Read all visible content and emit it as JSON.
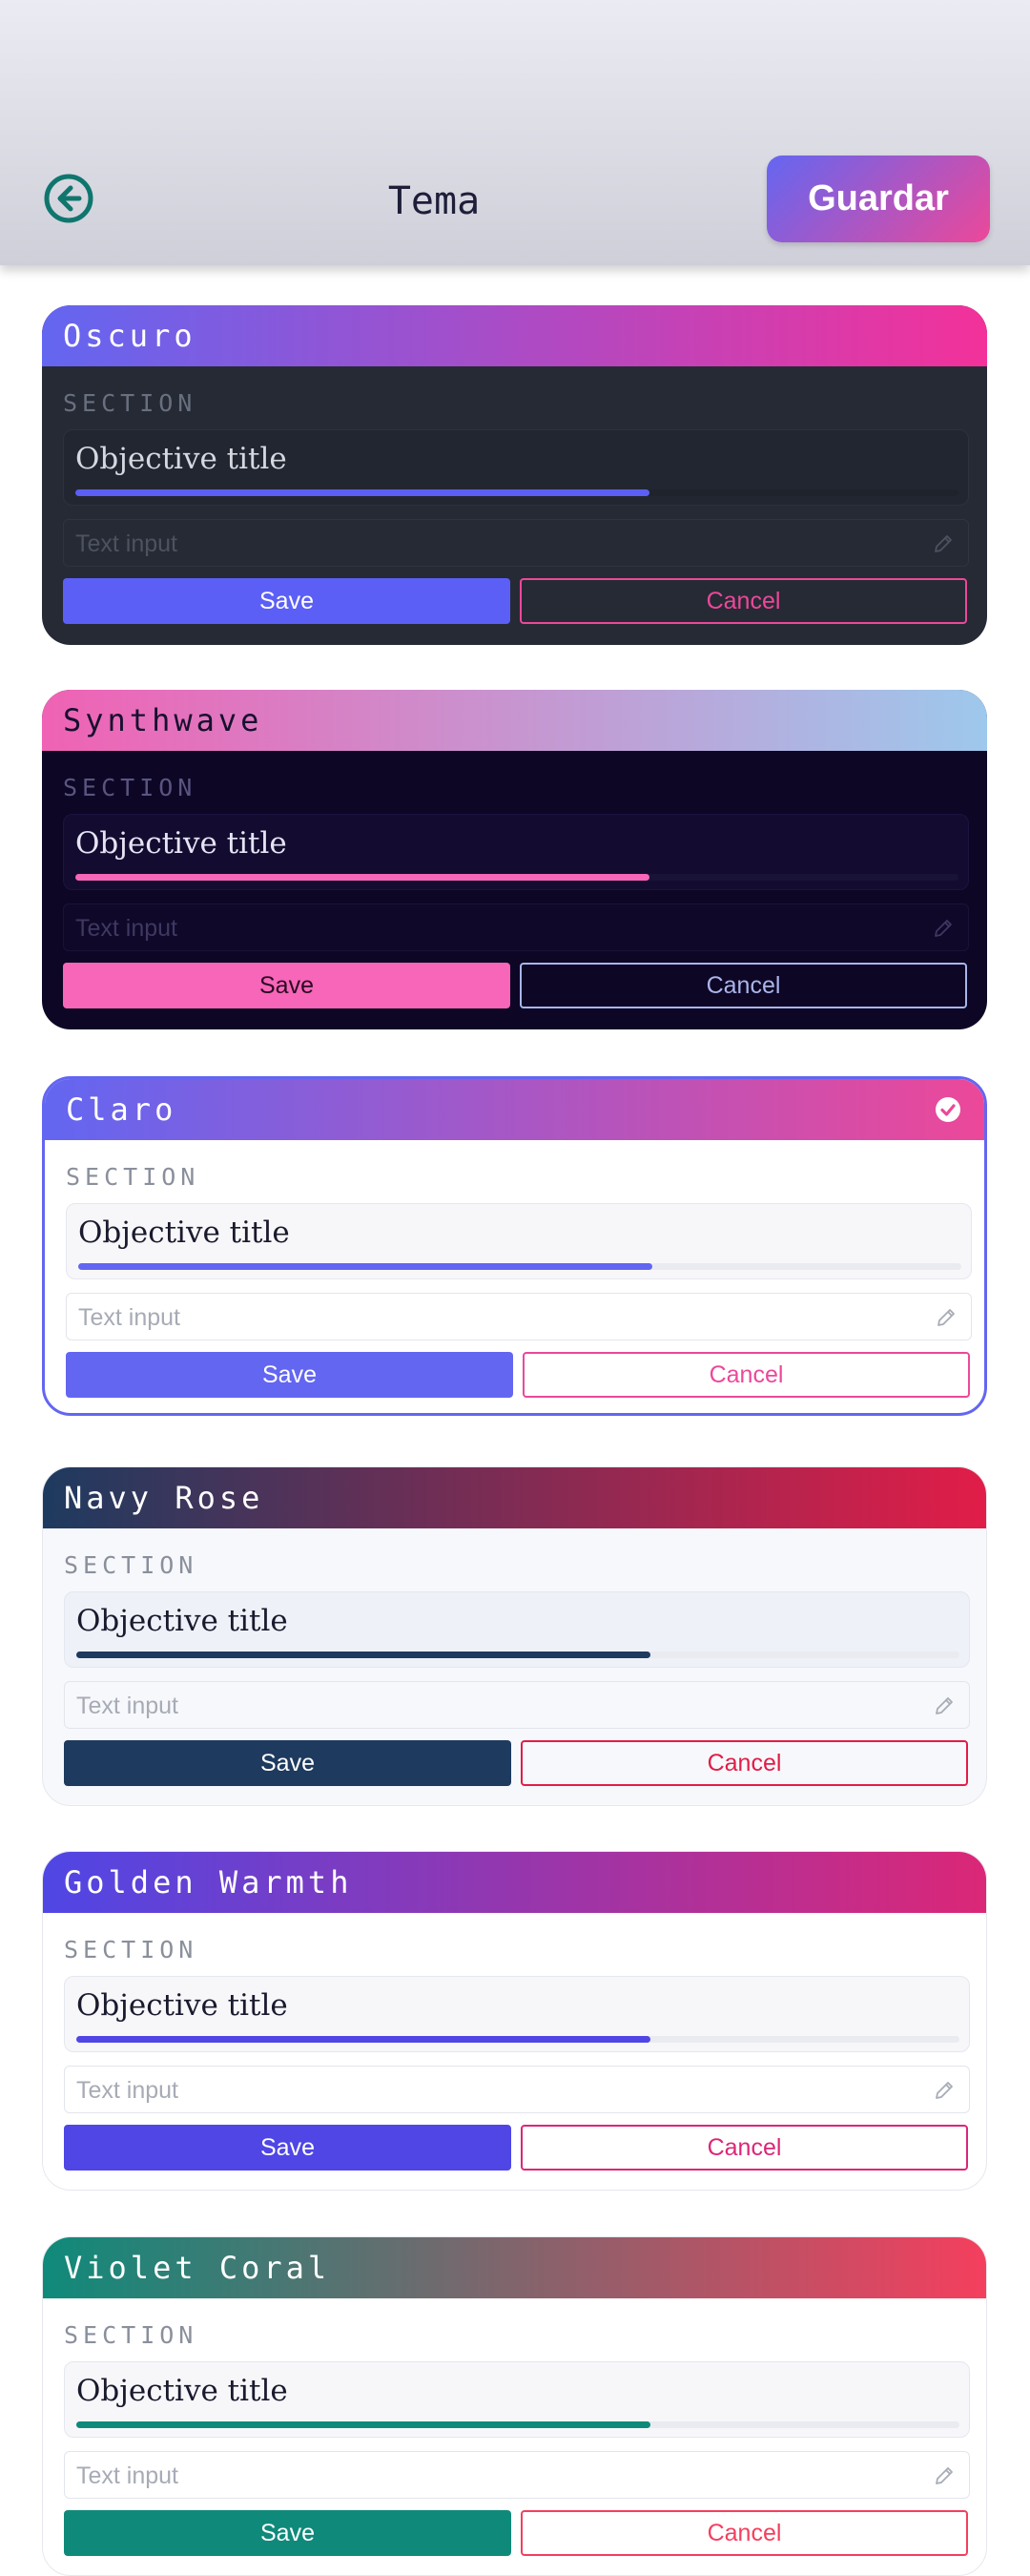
{
  "header": {
    "title": "Tema",
    "save_label": "Guardar"
  },
  "section_label": "SECTION",
  "objective_title": "Objective title",
  "progress_fraction": 0.65,
  "input_placeholder": "Text input",
  "save_label": "Save",
  "cancel_label": "Cancel",
  "themes": [
    {
      "name": "Oscuro",
      "selected": false,
      "colors": {
        "header_from": "#6366f1",
        "header_to": "#f3319a",
        "header_text": "#ffffff",
        "body": "#262a35",
        "accent": "#5b5ff5",
        "cancel": "#ec4899"
      }
    },
    {
      "name": "Synthwave",
      "selected": false,
      "colors": {
        "header_from": "#f062b4",
        "header_to": "#9ec8ec",
        "header_text": "#17102f",
        "body": "#0d0625",
        "accent": "#f766b8",
        "cancel": "#aab5ea"
      }
    },
    {
      "name": "Claro",
      "selected": true,
      "colors": {
        "header_from": "#6366f1",
        "header_to": "#ec4899",
        "header_text": "#ffffff",
        "body": "#ffffff",
        "accent": "#6366f1",
        "cancel": "#ec4899"
      }
    },
    {
      "name": "Navy Rose",
      "selected": false,
      "colors": {
        "header_from": "#1e3a5f",
        "header_to": "#e11d48",
        "header_text": "#ffffff",
        "body": "#f7f8fb",
        "accent": "#1e3a5f",
        "cancel": "#e11d48"
      }
    },
    {
      "name": "Golden Warmth",
      "selected": false,
      "colors": {
        "header_from": "#4f46e5",
        "header_to": "#db2777",
        "header_text": "#ffffff",
        "body": "#ffffff",
        "accent": "#4f46e5",
        "cancel": "#db2777"
      }
    },
    {
      "name": "Violet Coral",
      "selected": false,
      "colors": {
        "header_from": "#0f8a7a",
        "header_to": "#f43f5e",
        "header_text": "#ffffff",
        "body": "#ffffff",
        "accent": "#0f8a7a",
        "cancel": "#f43f5e"
      }
    }
  ]
}
